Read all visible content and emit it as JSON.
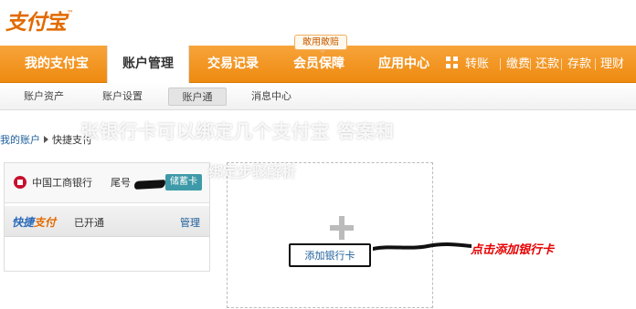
{
  "logo": {
    "text": "支付宝",
    "tm": "™"
  },
  "main_nav": {
    "items": [
      {
        "label": "我的支付宝",
        "active": false
      },
      {
        "label": "账户管理",
        "active": true
      },
      {
        "label": "交易记录",
        "active": false
      },
      {
        "label": "会员保障",
        "active": false
      },
      {
        "label": "应用中心",
        "active": false
      }
    ],
    "badge": "敢用敢赔",
    "quick_links": [
      "转账",
      "缴费",
      "还款",
      "存款",
      "理财"
    ]
  },
  "sub_nav": {
    "items": [
      {
        "label": "账户资产",
        "active": false
      },
      {
        "label": "账户设置",
        "active": false
      },
      {
        "label": "账户通",
        "active": true
      },
      {
        "label": "消息中心",
        "active": false
      }
    ]
  },
  "breadcrumb": {
    "parent": "我的账户",
    "current": "快捷支付"
  },
  "watermark": {
    "line1": "张银行卡可以绑定几个支付宝 答案和",
    "line2": "绑定步骤解析"
  },
  "bank_card": {
    "bank_name": "中国工商银行",
    "tail_label": "尾号",
    "card_type": "储蓄卡"
  },
  "quick_pay": {
    "logo_part1": "快捷",
    "logo_part2": "支付",
    "status": "已开通",
    "manage": "管理"
  },
  "add_card": {
    "button_label": "添加银行卡"
  },
  "annotation": {
    "text": "点击添加银行卡",
    "color": "#e60000"
  },
  "colors": {
    "orange": "#ee8a10",
    "link": "#1d5d9a",
    "card_badge": "#3e9aa8"
  }
}
